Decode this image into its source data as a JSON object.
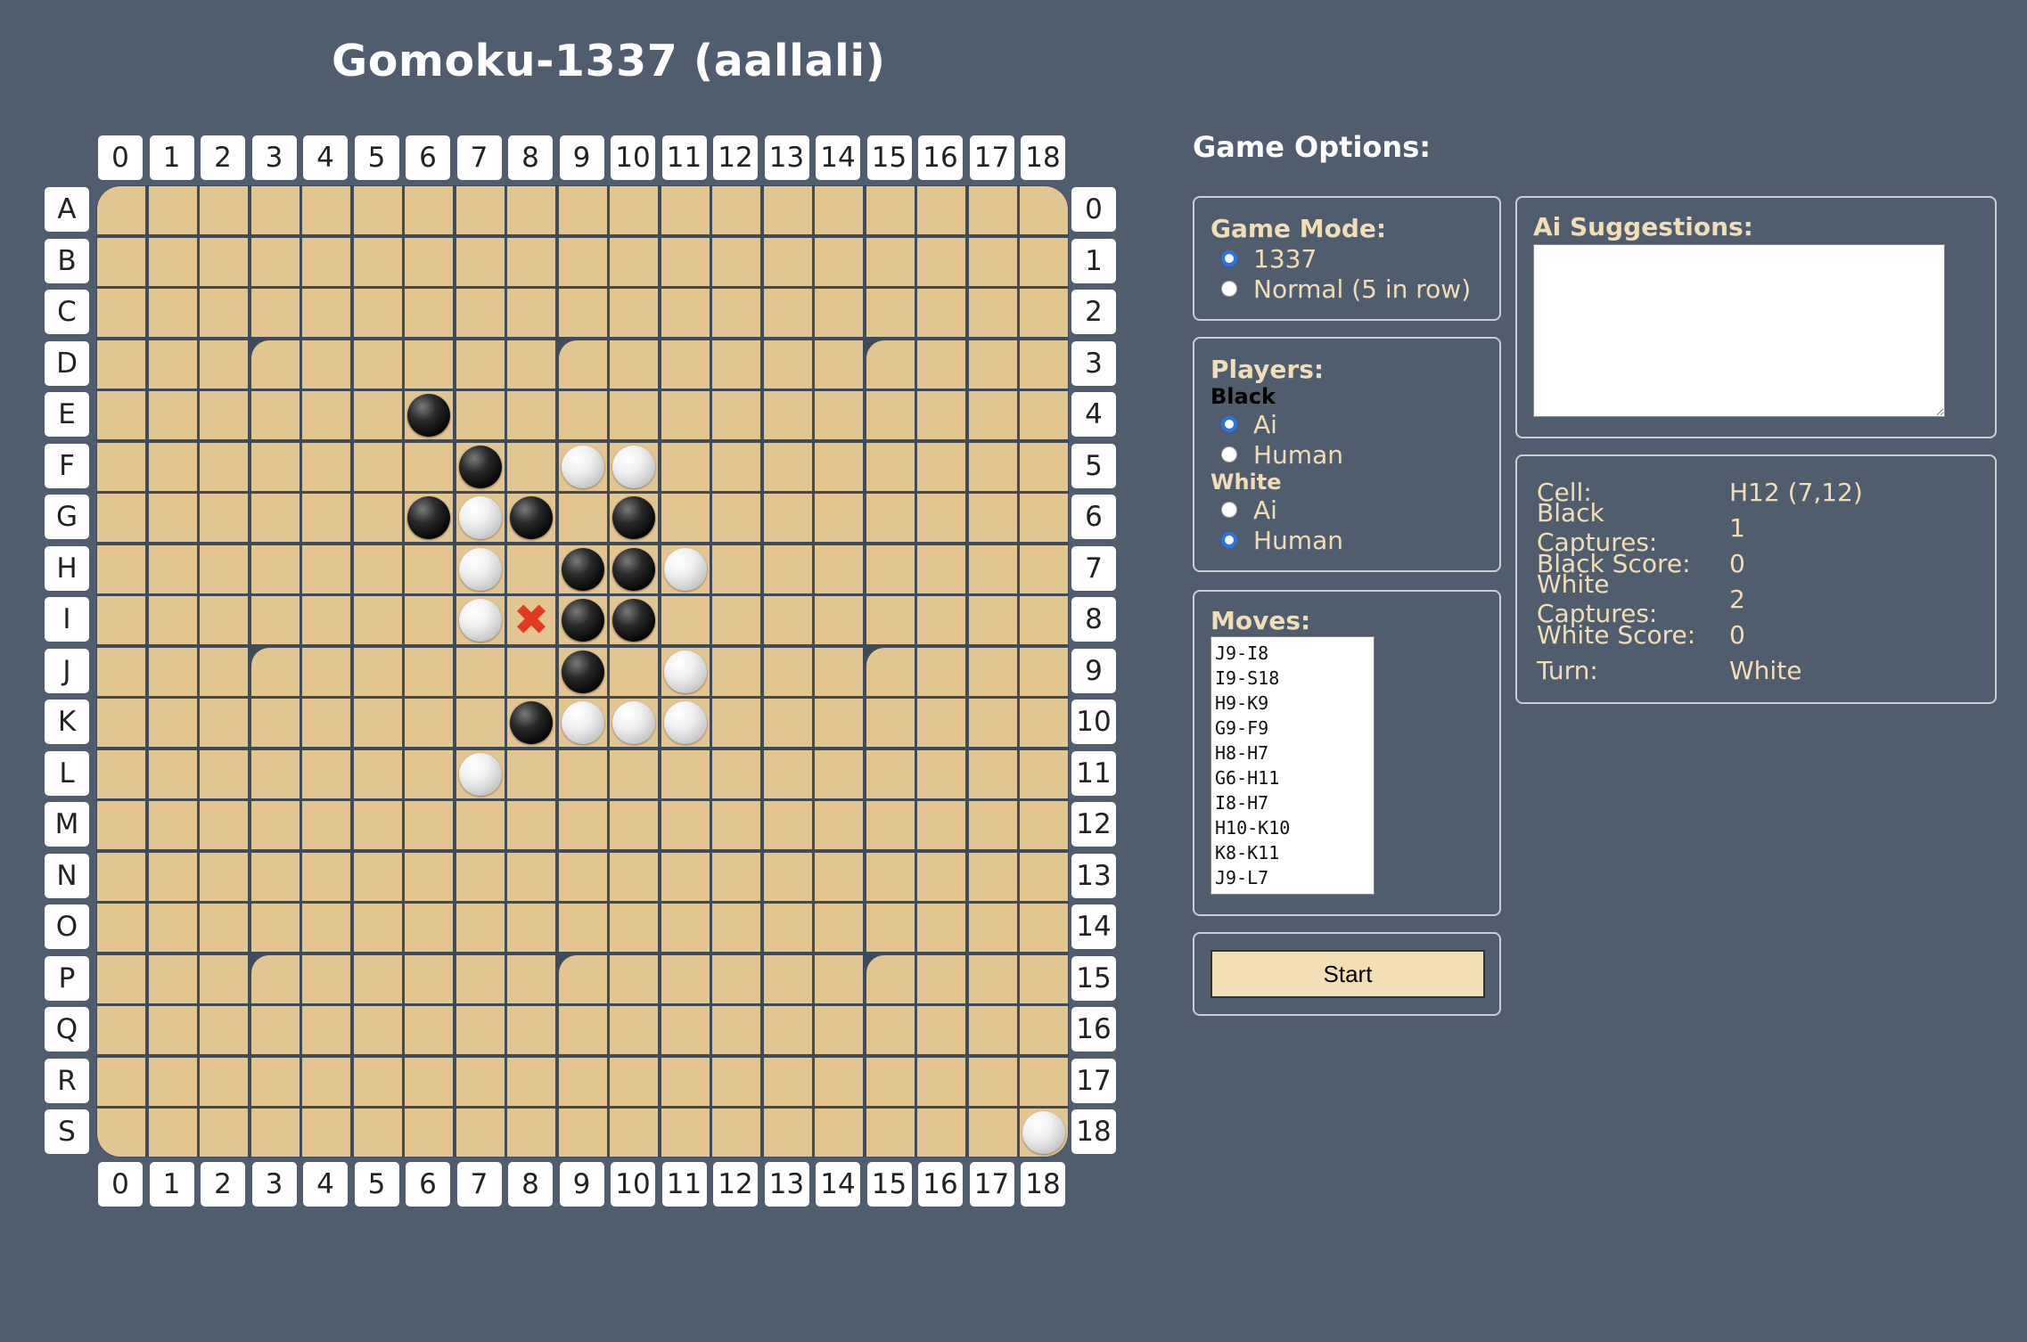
{
  "title": "Gomoku-1337 (aallali)",
  "board": {
    "size": 19,
    "col_labels": [
      "0",
      "1",
      "2",
      "3",
      "4",
      "5",
      "6",
      "7",
      "8",
      "9",
      "10",
      "11",
      "12",
      "13",
      "14",
      "15",
      "16",
      "17",
      "18"
    ],
    "row_labels": [
      "A",
      "B",
      "C",
      "D",
      "E",
      "F",
      "G",
      "H",
      "I",
      "J",
      "K",
      "L",
      "M",
      "N",
      "O",
      "P",
      "Q",
      "R",
      "S"
    ],
    "right_labels": [
      "0",
      "1",
      "2",
      "3",
      "4",
      "5",
      "6",
      "7",
      "8",
      "9",
      "10",
      "11",
      "12",
      "13",
      "14",
      "15",
      "16",
      "17",
      "18"
    ],
    "stones": [
      {
        "row": 4,
        "col": 6,
        "color": "black"
      },
      {
        "row": 5,
        "col": 7,
        "color": "black"
      },
      {
        "row": 5,
        "col": 9,
        "color": "white"
      },
      {
        "row": 5,
        "col": 10,
        "color": "white"
      },
      {
        "row": 6,
        "col": 6,
        "color": "black"
      },
      {
        "row": 6,
        "col": 7,
        "color": "white"
      },
      {
        "row": 6,
        "col": 8,
        "color": "black"
      },
      {
        "row": 6,
        "col": 10,
        "color": "black"
      },
      {
        "row": 7,
        "col": 7,
        "color": "white"
      },
      {
        "row": 7,
        "col": 9,
        "color": "black"
      },
      {
        "row": 7,
        "col": 10,
        "color": "black"
      },
      {
        "row": 7,
        "col": 11,
        "color": "white"
      },
      {
        "row": 8,
        "col": 7,
        "color": "white"
      },
      {
        "row": 8,
        "col": 9,
        "color": "black"
      },
      {
        "row": 8,
        "col": 10,
        "color": "black"
      },
      {
        "row": 9,
        "col": 9,
        "color": "black"
      },
      {
        "row": 9,
        "col": 11,
        "color": "white"
      },
      {
        "row": 10,
        "col": 8,
        "color": "black"
      },
      {
        "row": 10,
        "col": 9,
        "color": "white"
      },
      {
        "row": 10,
        "col": 10,
        "color": "white"
      },
      {
        "row": 10,
        "col": 11,
        "color": "white"
      },
      {
        "row": 11,
        "col": 7,
        "color": "white"
      },
      {
        "row": 18,
        "col": 18,
        "color": "white"
      }
    ],
    "marker": {
      "row": 8,
      "col": 8,
      "symbol": "✖",
      "color": "#e23a22"
    },
    "star_points": [
      [
        3,
        3
      ],
      [
        3,
        9
      ],
      [
        3,
        15
      ],
      [
        9,
        3
      ],
      [
        9,
        15
      ],
      [
        15,
        3
      ],
      [
        15,
        9
      ],
      [
        15,
        15
      ]
    ],
    "cell_color": "#e2c591",
    "grid_color": "#3f4a5a"
  },
  "options": {
    "heading": "Game Options:",
    "game_mode": {
      "title": "Game Mode:",
      "options": [
        "1337",
        "Normal (5 in row)"
      ],
      "selected": 0
    },
    "players": {
      "title": "Players:",
      "black_label": "Black",
      "black_options": [
        "Ai",
        "Human"
      ],
      "black_selected": 0,
      "white_label": "White",
      "white_options": [
        "Ai",
        "Human"
      ],
      "white_selected": 1
    },
    "moves": {
      "title": "Moves:",
      "list": [
        "J9-I8",
        "I9-S18",
        "H9-K9",
        "G9-F9",
        "H8-H7",
        "G6-H11",
        "I8-H7",
        "H10-K10",
        "K8-K11",
        "J9-L7"
      ]
    },
    "start_label": "Start",
    "ai_suggestions": {
      "title": "Ai Suggestions:",
      "value": ""
    }
  },
  "info": {
    "cell_label": "Cell:",
    "cell_value": "H12 (7,12)",
    "black_captures_label": "Black Captures:",
    "black_captures_value": "1",
    "black_score_label": "Black Score:",
    "black_score_value": "0",
    "white_captures_label": "White Captures:",
    "white_captures_value": "2",
    "white_score_label": "White Score:",
    "white_score_value": "0",
    "turn_label": "Turn:",
    "turn_value": "White"
  },
  "colors": {
    "background": "#505d6f",
    "accent_text": "#f1deb6",
    "radio_selected": "#2c74e6"
  }
}
